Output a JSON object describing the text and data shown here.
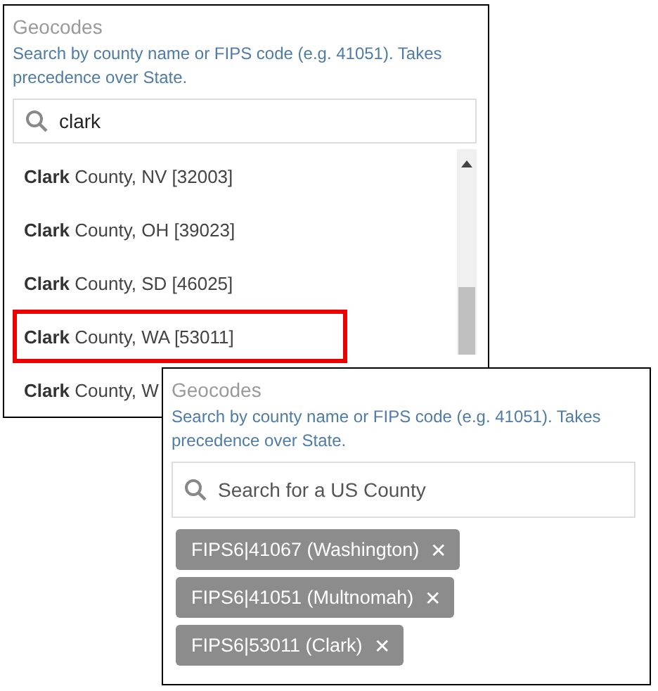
{
  "panels": [
    {
      "title": "Geocodes",
      "help": "Search by county name or FIPS code (e.g. 41051). Takes precedence over State.",
      "search": {
        "value": "clark"
      },
      "results": [
        {
          "label": "**Clark** County, NV [32003]",
          "highlighted": false
        },
        {
          "label": "**Clark** County, OH [39023]",
          "highlighted": false
        },
        {
          "label": "**Clark** County, SD [46025]",
          "highlighted": false
        },
        {
          "label": "**Clark** County, WA [53011]",
          "highlighted": true
        },
        {
          "label": "**Clark** County, W",
          "highlighted": false
        }
      ]
    },
    {
      "title": "Geocodes",
      "help": "Search by county name or FIPS code (e.g. 41051). Takes precedence over State.",
      "search": {
        "placeholder": "Search for a US County"
      },
      "tags": [
        {
          "label": "FIPS6|41067 (Washington)",
          "remove": "✕"
        },
        {
          "label": "FIPS6|41051 (Multnomah)",
          "remove": "✕"
        },
        {
          "label": "FIPS6|53011 (Clark)",
          "remove": "✕"
        }
      ]
    }
  ]
}
